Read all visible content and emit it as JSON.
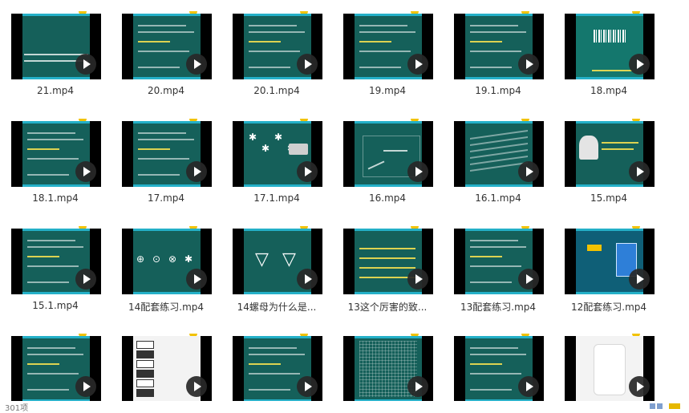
{
  "files": [
    {
      "name": "21.mp4"
    },
    {
      "name": "20.mp4"
    },
    {
      "name": "20.1.mp4"
    },
    {
      "name": "19.mp4"
    },
    {
      "name": "19.1.mp4"
    },
    {
      "name": "18.mp4"
    },
    {
      "name": "18.1.mp4"
    },
    {
      "name": "17.mp4"
    },
    {
      "name": "17.1.mp4"
    },
    {
      "name": "16.mp4"
    },
    {
      "name": "16.1.mp4"
    },
    {
      "name": "15.mp4"
    },
    {
      "name": "15.1.mp4"
    },
    {
      "name": "14配套练习.mp4"
    },
    {
      "name": "14螺母为什么是..."
    },
    {
      "name": "13这个厉害的致..."
    },
    {
      "name": "13配套练习.mp4"
    },
    {
      "name": "12配套练习.mp4"
    },
    {
      "name": ""
    },
    {
      "name": ""
    },
    {
      "name": ""
    },
    {
      "name": ""
    },
    {
      "name": ""
    },
    {
      "name": ""
    }
  ],
  "status": {
    "item_count": "301项"
  },
  "colors": {
    "slide_bg": "#15605a",
    "slide_border": "#24b0c8",
    "accent_tab": "#f2c200"
  }
}
